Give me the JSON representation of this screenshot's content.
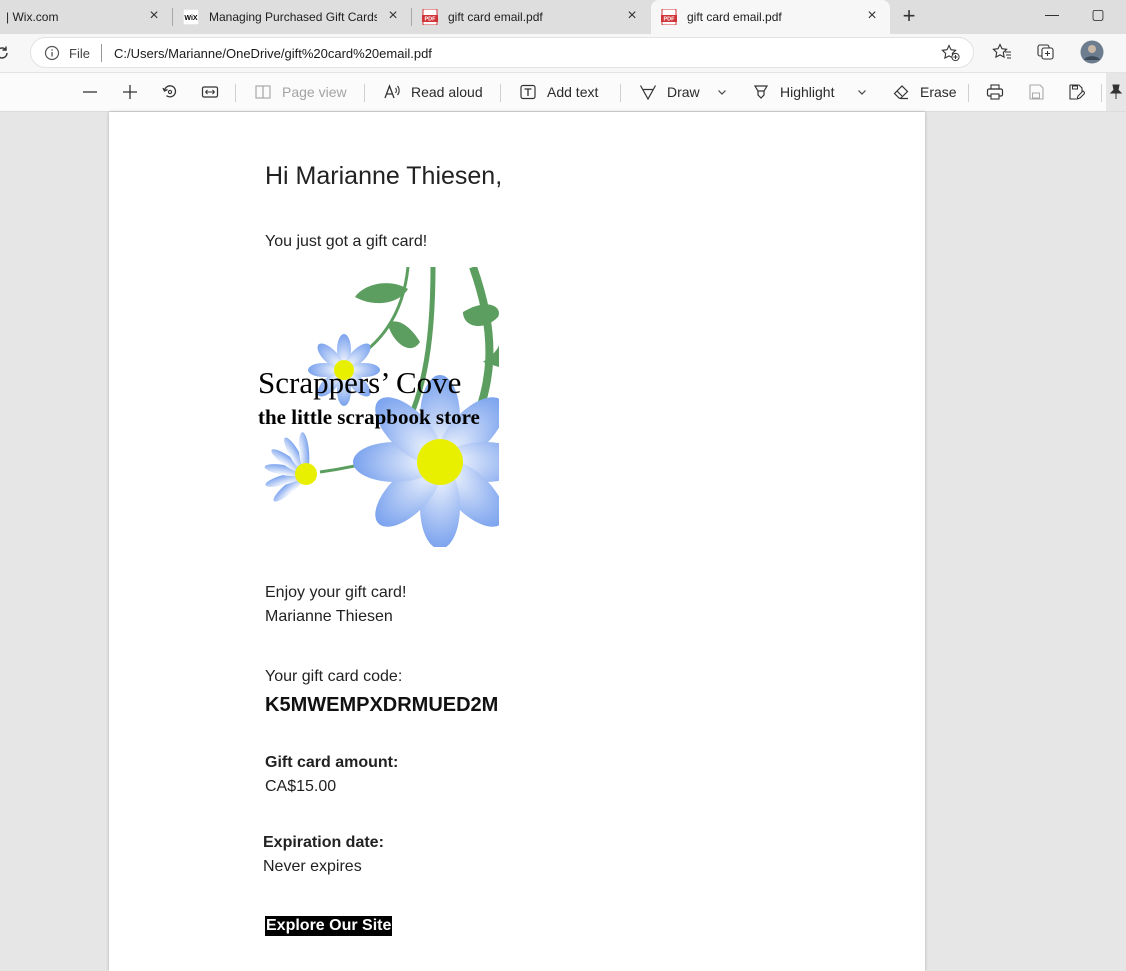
{
  "tabs": [
    {
      "title": "| Wix.com"
    },
    {
      "title": "Managing Purchased Gift Cards |",
      "favicon": "WiX"
    },
    {
      "title": "gift card email.pdf",
      "favicon": "PDF"
    },
    {
      "title": "gift card email.pdf",
      "favicon": "PDF"
    }
  ],
  "address": {
    "scheme_label": "File",
    "url": "C:/Users/Marianne/OneDrive/gift%20card%20email.pdf"
  },
  "toolbar": {
    "page_view": "Page view",
    "read_aloud": "Read aloud",
    "add_text": "Add text",
    "draw": "Draw",
    "highlight": "Highlight",
    "erase": "Erase"
  },
  "email": {
    "greeting": "Hi Marianne Thiesen,",
    "intro": "You just got a gift card!",
    "card_image": {
      "title": "Scrappers’ Cove",
      "subtitle": "the little scrapbook store"
    },
    "enjoy": "Enjoy your gift card!",
    "sender": "Marianne Thiesen",
    "code_label": "Your gift card code:",
    "code": "K5MWEMPXDRMUED2M",
    "amount_label": "Gift card amount:",
    "amount": "CA$15.00",
    "expiration_label": "Expiration date:",
    "expiration": "Never expires",
    "cta": "Explore Our Site"
  },
  "colors": {
    "pdf_red": "#d13438",
    "leaf_green": "#5c9e5f",
    "petal_blue": "#8fb1f2",
    "flower_center": "#e8f000"
  }
}
